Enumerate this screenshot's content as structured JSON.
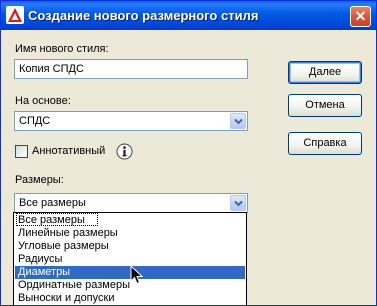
{
  "window": {
    "title": "Создание нового размерного стиля",
    "close_glyph": "✕"
  },
  "form": {
    "new_style_name_label": "Имя нового стиля:",
    "new_style_name_value": "Копия СПДС",
    "based_on_label": "На основе:",
    "based_on_value": "СПДС",
    "annotative_label": "Аннотативный",
    "annotative_checked": false,
    "use_for_label": "Размеры:",
    "use_for_value": "Все размеры"
  },
  "buttons": {
    "continue_label": "Далее",
    "cancel_label": "Отмена",
    "help_label": "Справка"
  },
  "dropdown": {
    "items": [
      "Все размеры",
      "Линейные размеры",
      "Угловые размеры",
      "Радиусы",
      "Диаметры",
      "Ординатные размеры",
      "Выноски и допуски"
    ],
    "selected_index": 4,
    "focused_index": 0
  },
  "icons": {
    "app_icon": "autocad-logo-icon",
    "info_icon": "info-icon",
    "dropdown_arrow": "chevron-down-icon",
    "cursor": "mouse-pointer-icon"
  },
  "colors": {
    "titlebar": "#0058e6",
    "close_button": "#d65a3a",
    "selection": "#316ac5",
    "dialog_bg": "#ece9d8",
    "field_border": "#7f9db9"
  }
}
